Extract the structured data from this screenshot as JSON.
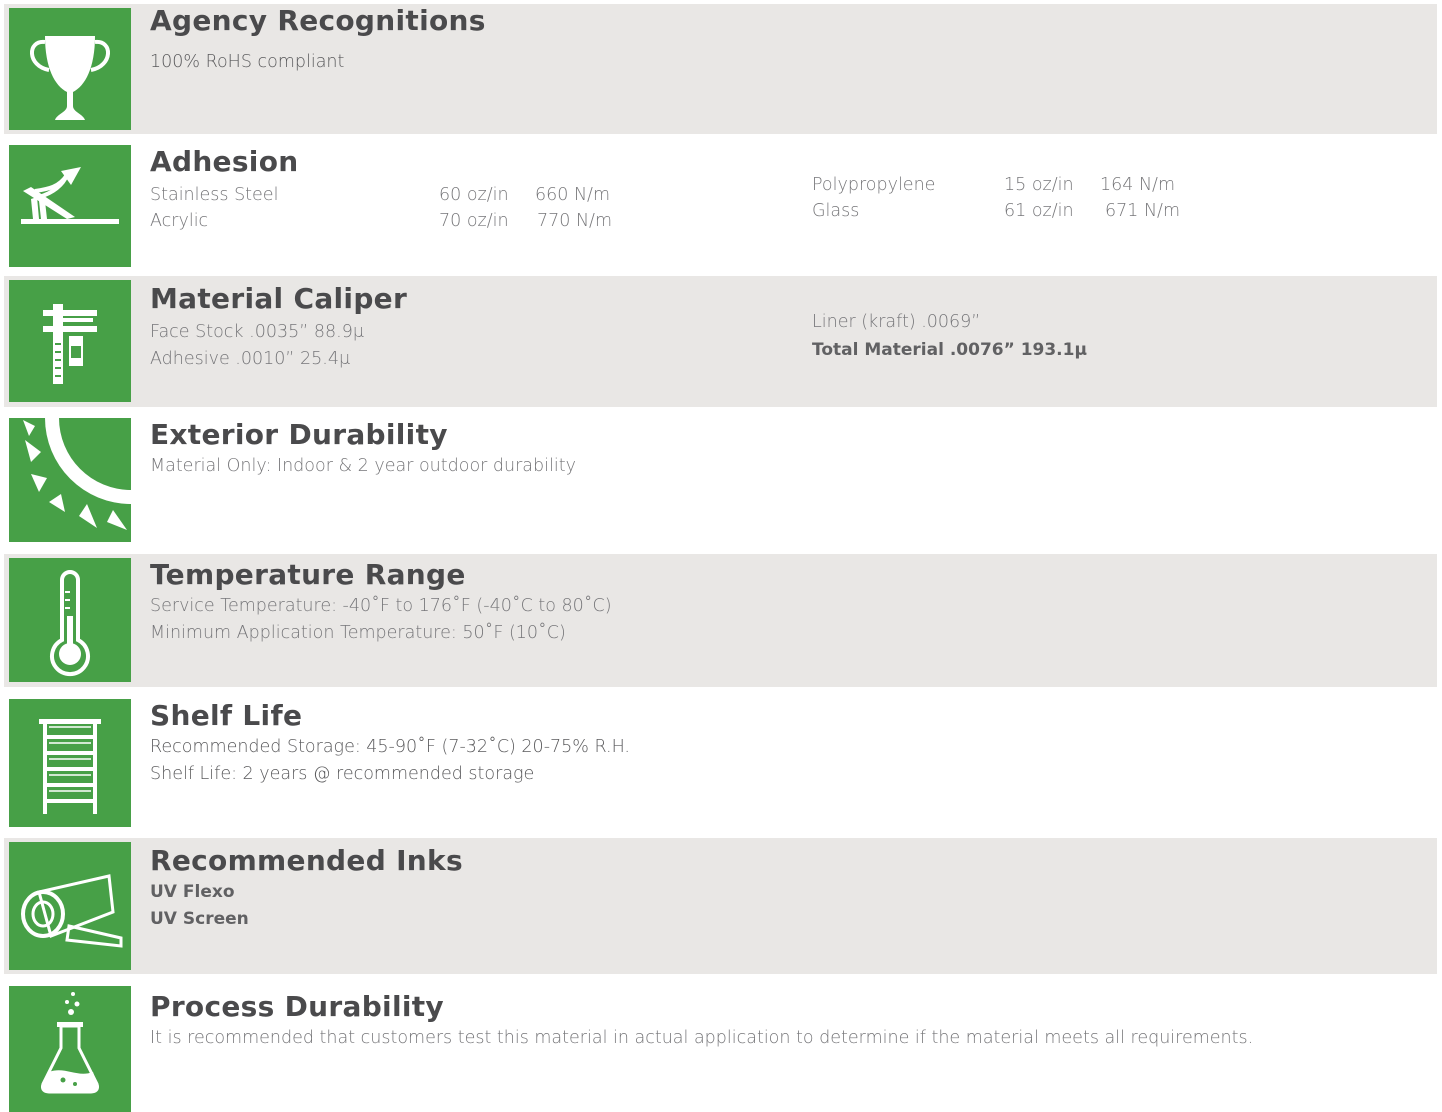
{
  "sections": {
    "agency": {
      "title": "Agency Recognitions",
      "lines": [
        "100% RoHS compliant"
      ]
    },
    "adhesion": {
      "title": "Adhesion",
      "rows": [
        {
          "material": "Stainless Steel",
          "oz": "60 oz/in",
          "nm": "660 N/m"
        },
        {
          "material": "Acrylic",
          "oz": "70 oz/in",
          "nm": "770 N/m"
        },
        {
          "material": "Polypropylene",
          "oz": "15 oz/in",
          "nm": "164 N/m"
        },
        {
          "material": "Glass",
          "oz": "61 oz/in",
          "nm": "671 N/m"
        }
      ]
    },
    "caliper": {
      "title": "Material Caliper",
      "lines": [
        "Face Stock .0035” 88.9μ",
        "Adhesive .0010” 25.4μ",
        "Liner (kraft) .0069”",
        "Total Material .0076” 193.1μ"
      ]
    },
    "exterior": {
      "title": "Exterior Durability",
      "lines": [
        "Material Only: Indoor & 2 year outdoor durability"
      ]
    },
    "temperature": {
      "title": "Temperature Range",
      "lines": [
        "Service Temperature: -40˚F to 176˚F (-40˚C to 80˚C)",
        "Minimum Application Temperature: 50˚F (10˚C)"
      ]
    },
    "shelf": {
      "title": "Shelf Life",
      "lines": [
        "Recommended Storage: 45-90˚F (7-32˚C) 20-75% R.H.",
        "Shelf Life: 2 years @ recommended storage"
      ]
    },
    "inks": {
      "title": "Recommended Inks",
      "lines": [
        "UV Flexo",
        "UV Screen"
      ]
    },
    "process": {
      "title": "Process Durability",
      "lines": [
        "It is recommended that customers test this material in actual application to determine if the material meets all requirements."
      ]
    }
  },
  "icons": [
    "trophy-icon",
    "adhesion-icon",
    "caliper-icon",
    "sun-icon",
    "thermometer-icon",
    "shelf-icon",
    "roll-icon",
    "flask-icon"
  ],
  "colors": {
    "accent": "#47a047",
    "shade": "#e9e7e5",
    "title": "#4a4a4c",
    "text": "#767679"
  }
}
